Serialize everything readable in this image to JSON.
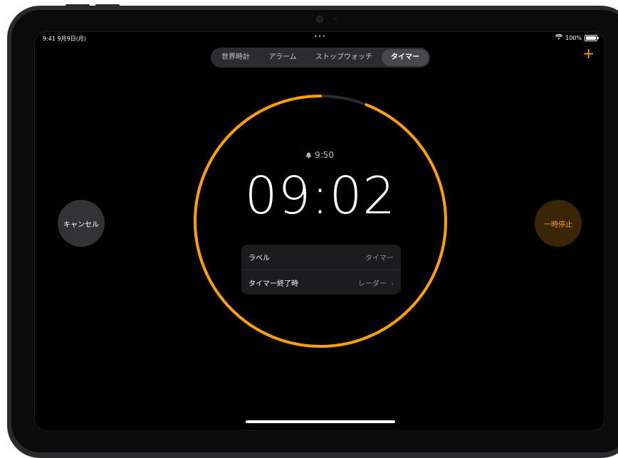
{
  "status_bar": {
    "time": "9:41",
    "date": "9月9日(月)",
    "battery": "100%"
  },
  "tabs": [
    {
      "label": "世界時計",
      "active": false
    },
    {
      "label": "アラーム",
      "active": false
    },
    {
      "label": "ストップウォッチ",
      "active": false
    },
    {
      "label": "タイマー",
      "active": true
    }
  ],
  "add_button": {
    "label": "+"
  },
  "timer": {
    "alarm_time": "9:50",
    "countdown": "09:02",
    "progress_fraction": 0.94
  },
  "settings": {
    "rows": [
      {
        "label": "ラベル",
        "value": "タイマー"
      },
      {
        "label": "タイマー終了時",
        "value": "レーダー"
      }
    ]
  },
  "buttons": {
    "cancel": "キャンセル",
    "pause": "一時停止"
  },
  "colors": {
    "accent": "#ff9f0a",
    "track": "#2c2c2e",
    "background": "#000000"
  }
}
